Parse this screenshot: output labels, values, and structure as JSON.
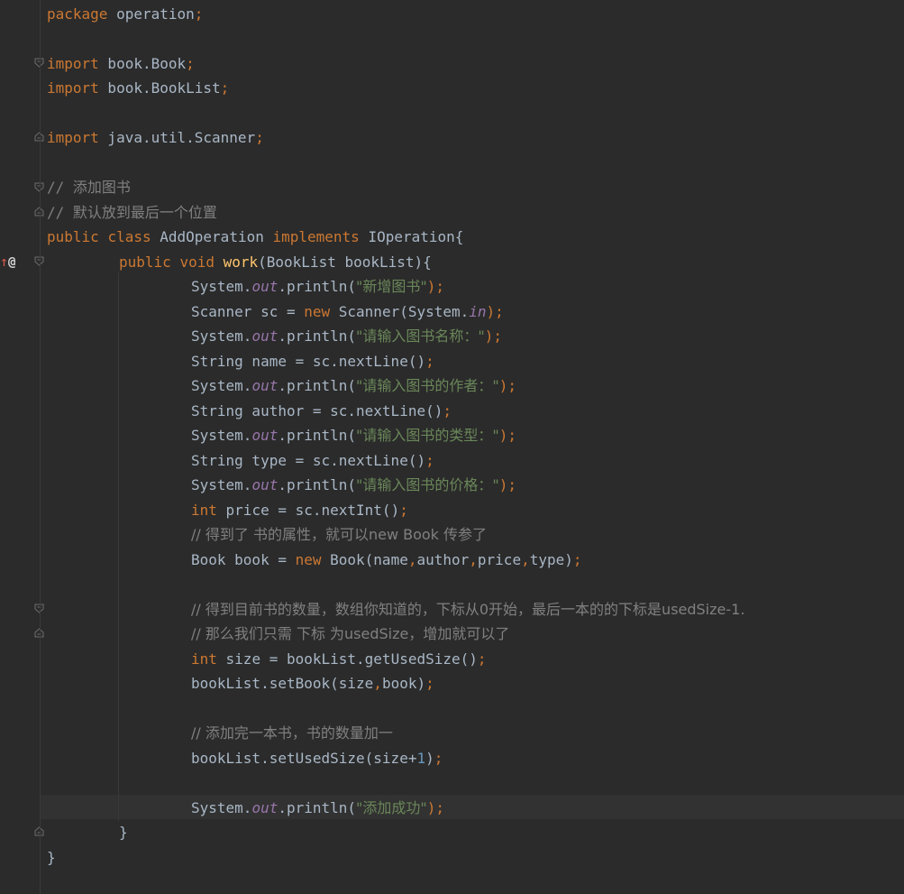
{
  "code": {
    "line1": {
      "kw": "package",
      "rest": " operation",
      "semi": ";"
    },
    "line3": {
      "kw": "import",
      "rest": " book.Book",
      "semi": ";"
    },
    "line4": {
      "kw": "import",
      "rest": " book.BookList",
      "semi": ";"
    },
    "line6": {
      "kw": "import",
      "rest": " java.util.Scanner",
      "semi": ";"
    },
    "line8": {
      "text": "// 添加图书"
    },
    "line9": {
      "text": "// 默认放到最后一个位置"
    },
    "line10": {
      "kw1": "public",
      "kw2": "class",
      "name": "AddOperation",
      "kw3": "implements",
      "iface": "IOperation{"
    },
    "line11": {
      "kw1": "public",
      "kw2": "void",
      "fn": "work",
      "params": "(BookList bookList){"
    },
    "line12": {
      "pre": "System.",
      "fld": "out",
      "mid": ".println(",
      "str": "\"新增图书\"",
      "end": ");"
    },
    "line13": {
      "pre": "Scanner sc = ",
      "kw": "new",
      "mid": " Scanner(System.",
      "fld": "in",
      "end": ");"
    },
    "line14": {
      "pre": "System.",
      "fld": "out",
      "mid": ".println(",
      "str": "\"请输入图书名称：\"",
      "end": ");"
    },
    "line15": {
      "pre": "String name = sc.nextLine()",
      "end": ";"
    },
    "line16": {
      "pre": "System.",
      "fld": "out",
      "mid": ".println(",
      "str": "\"请输入图书的作者：\"",
      "end": ");"
    },
    "line17": {
      "pre": "String author = sc.nextLine()",
      "end": ";"
    },
    "line18": {
      "pre": "System.",
      "fld": "out",
      "mid": ".println(",
      "str": "\"请输入图书的类型：\"",
      "end": ");"
    },
    "line19": {
      "pre": "String type = sc.nextLine()",
      "end": ";"
    },
    "line20": {
      "pre": "System.",
      "fld": "out",
      "mid": ".println(",
      "str": "\"请输入图书的价格：\"",
      "end": ");"
    },
    "line21": {
      "kw": "int",
      "rest": " price = sc.nextInt()",
      "end": ";"
    },
    "line22": {
      "text": "// 得到了 书的属性，就可以new Book 传参了"
    },
    "line23": {
      "pre": "Book book = ",
      "kw": "new",
      "a": " Book(name",
      "c1": ",",
      "b": "author",
      "c2": ",",
      "c": "price",
      "c3": ",",
      "d": "type)",
      "end": ";"
    },
    "line25": {
      "text": "// 得到目前书的数量，数组你知道的，下标从0开始，最后一本的的下标是usedSize-1."
    },
    "line26": {
      "text": "// 那么我们只需 下标 为usedSize，增加就可以了"
    },
    "line27": {
      "kw": "int",
      "rest": " size = bookList.getUsedSize()",
      "end": ";"
    },
    "line28": {
      "pre": "bookList.setBook(size",
      "c": ",",
      "post": "book)",
      "end": ";"
    },
    "line30": {
      "text": "// 添加完一本书，书的数量加一"
    },
    "line31": {
      "pre": "bookList.setUsedSize(size+",
      "num": "1",
      "post": ")",
      "end": ";"
    },
    "line33": {
      "pre": "System.",
      "fld": "out",
      "mid": ".println(",
      "str": "\"添加成功\"",
      "end": ");"
    },
    "line34": {
      "text": "}"
    },
    "line35": {
      "text": "}"
    }
  },
  "gutter": {
    "override_marker": "@",
    "arrow": "↑"
  },
  "colors": {
    "background": "#2b2b2b",
    "keyword": "#cc7832",
    "string": "#6a8759",
    "comment": "#808080",
    "field": "#9876aa",
    "function": "#ffc66d",
    "number": "#6897bb",
    "text": "#a9b7c6"
  }
}
